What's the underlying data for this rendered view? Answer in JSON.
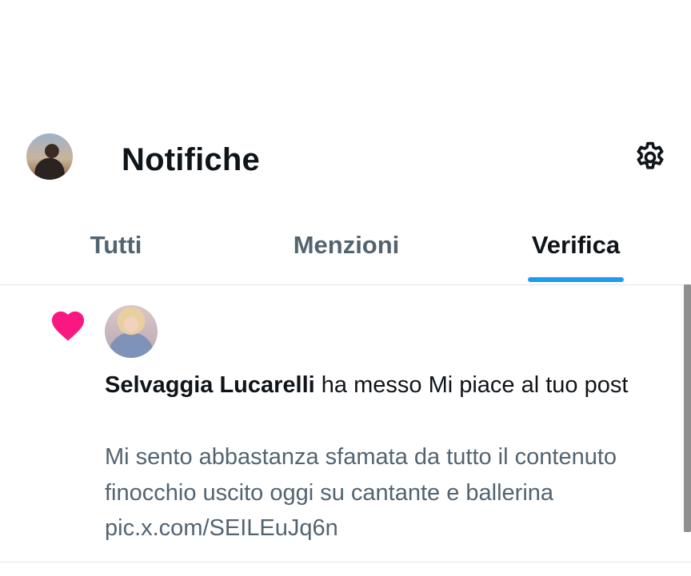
{
  "header": {
    "title": "Notifiche",
    "settings_icon": "gear-icon"
  },
  "tabs": [
    {
      "label": "Tutti",
      "active": false
    },
    {
      "label": "Menzioni",
      "active": false
    },
    {
      "label": "Verifica",
      "active": true
    }
  ],
  "notification": {
    "icon": "heart-icon",
    "icon_color": "#f91880",
    "user_name": "Selvaggia Lucarelli",
    "action_text": " ha messo Mi piace al tuo post",
    "post_text": "Mi sento abbastanza sfamata da tutto il contenuto finocchio uscito oggi su cantante e ballerina pic.x.com/SEILEuJq6n"
  },
  "colors": {
    "accent": "#1d9bf0",
    "text_primary": "#0f1419",
    "text_secondary": "#536471"
  }
}
